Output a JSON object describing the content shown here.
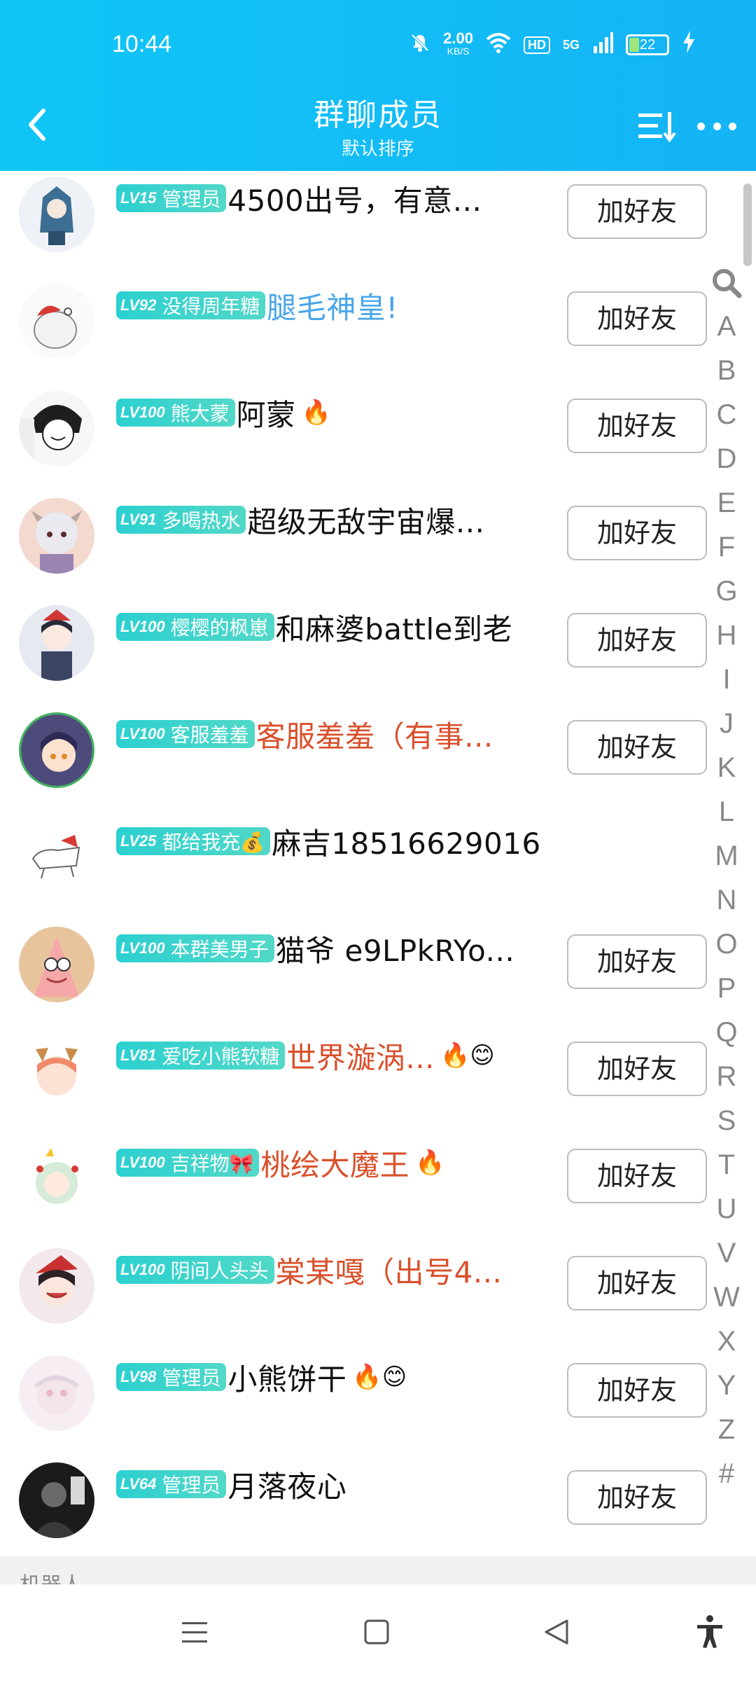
{
  "status": {
    "time": "10:44",
    "net_speed_value": "2.00",
    "net_speed_unit": "KB/S",
    "hd": "HD",
    "signal": "5G",
    "battery": "22"
  },
  "header": {
    "title": "群聊成员",
    "subtitle": "默认排序"
  },
  "members": [
    {
      "level": "LV15",
      "tag": "管理员",
      "nick": "4500出号，有意...",
      "nick_color": "normal",
      "emoji": "",
      "button": "加好友"
    },
    {
      "level": "LV92",
      "tag": "没得周年糖",
      "nick": "腿毛神皇!",
      "nick_color": "blue",
      "emoji": "",
      "button": "加好友"
    },
    {
      "level": "LV100",
      "tag": "熊大蒙",
      "nick": "阿蒙",
      "nick_color": "normal",
      "emoji": "🔥",
      "button": "加好友"
    },
    {
      "level": "LV91",
      "tag": "多喝热水",
      "nick": "超级无敌宇宙爆...",
      "nick_color": "normal",
      "emoji": "",
      "button": "加好友"
    },
    {
      "level": "LV100",
      "tag": "樱樱的枫崽",
      "nick": "和麻婆battle到老",
      "nick_color": "normal",
      "emoji": "",
      "button": "加好友"
    },
    {
      "level": "LV100",
      "tag": "客服羞羞",
      "nick": "客服羞羞（有事...",
      "nick_color": "red",
      "emoji": "",
      "button": "加好友"
    },
    {
      "level": "LV25",
      "tag": "都给我充💰",
      "nick": "麻吉18516629016",
      "nick_color": "normal",
      "emoji": "",
      "button": ""
    },
    {
      "level": "LV100",
      "tag": "本群美男子",
      "nick": "猫爷 e9LPkRYo...",
      "nick_color": "normal",
      "emoji": "",
      "button": "加好友"
    },
    {
      "level": "LV81",
      "tag": "爱吃小熊软糖",
      "nick": "世界漩涡...",
      "nick_color": "red",
      "emoji": "🔥😊",
      "button": "加好友"
    },
    {
      "level": "LV100",
      "tag": "吉祥物🎀",
      "nick": "桃绘大魔王",
      "nick_color": "red",
      "emoji": "🔥",
      "button": "加好友"
    },
    {
      "level": "LV100",
      "tag": "阴间人头头",
      "nick": "棠某嘎（出号4...",
      "nick_color": "red",
      "emoji": "",
      "button": "加好友"
    },
    {
      "level": "LV98",
      "tag": "管理员",
      "nick": "小熊饼干",
      "nick_color": "normal",
      "emoji": "🔥😊",
      "button": "加好友"
    },
    {
      "level": "LV64",
      "tag": "管理员",
      "nick": "月落夜心",
      "nick_color": "normal",
      "emoji": "",
      "button": "加好友"
    }
  ],
  "index_letters": [
    "A",
    "B",
    "C",
    "D",
    "E",
    "F",
    "G",
    "H",
    "I",
    "J",
    "K",
    "L",
    "M",
    "N",
    "O",
    "P",
    "Q",
    "R",
    "S",
    "T",
    "U",
    "V",
    "W",
    "X",
    "Y",
    "Z",
    "#"
  ],
  "section_label": "机器人",
  "colors": {
    "header_bg": "#14b8f5",
    "badge_bg": "#2cd0d0",
    "nick_red": "#d9502b",
    "nick_blue": "#4aa6e8"
  },
  "icons": {
    "back": "chevron-left-icon",
    "sort": "sort-icon",
    "more": "more-dots-icon",
    "search": "search-icon",
    "nav_menu": "menu-icon",
    "nav_home": "home-square-icon",
    "nav_back": "back-triangle-icon",
    "nav_accessibility": "accessibility-icon"
  }
}
